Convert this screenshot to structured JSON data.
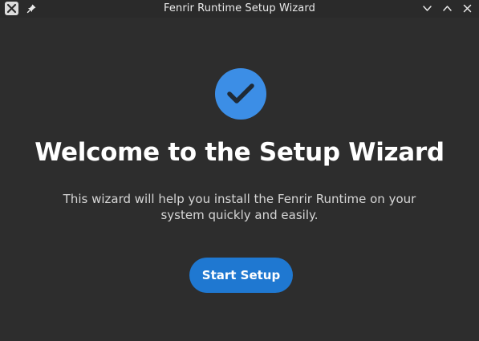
{
  "window": {
    "title": "Fenrir Runtime Setup Wizard"
  },
  "titlebar": {
    "app_icon": "x-app-icon",
    "pin_icon": "pin-icon",
    "controls": [
      "chevron-down-icon",
      "chevron-up-icon",
      "close-icon"
    ]
  },
  "main": {
    "status_icon": "checkmark-circle-icon",
    "heading": "Welcome to the Setup Wizard",
    "description": "This wizard will help you install the Fenrir Runtime on your system quickly and easily.",
    "start_button_label": "Start Setup"
  },
  "colors": {
    "background": "#2d2d2d",
    "accent_circle": "#3c8ee6",
    "button": "#1f78d1",
    "heading_text": "#ffffff",
    "body_text": "#d6d6d6"
  }
}
